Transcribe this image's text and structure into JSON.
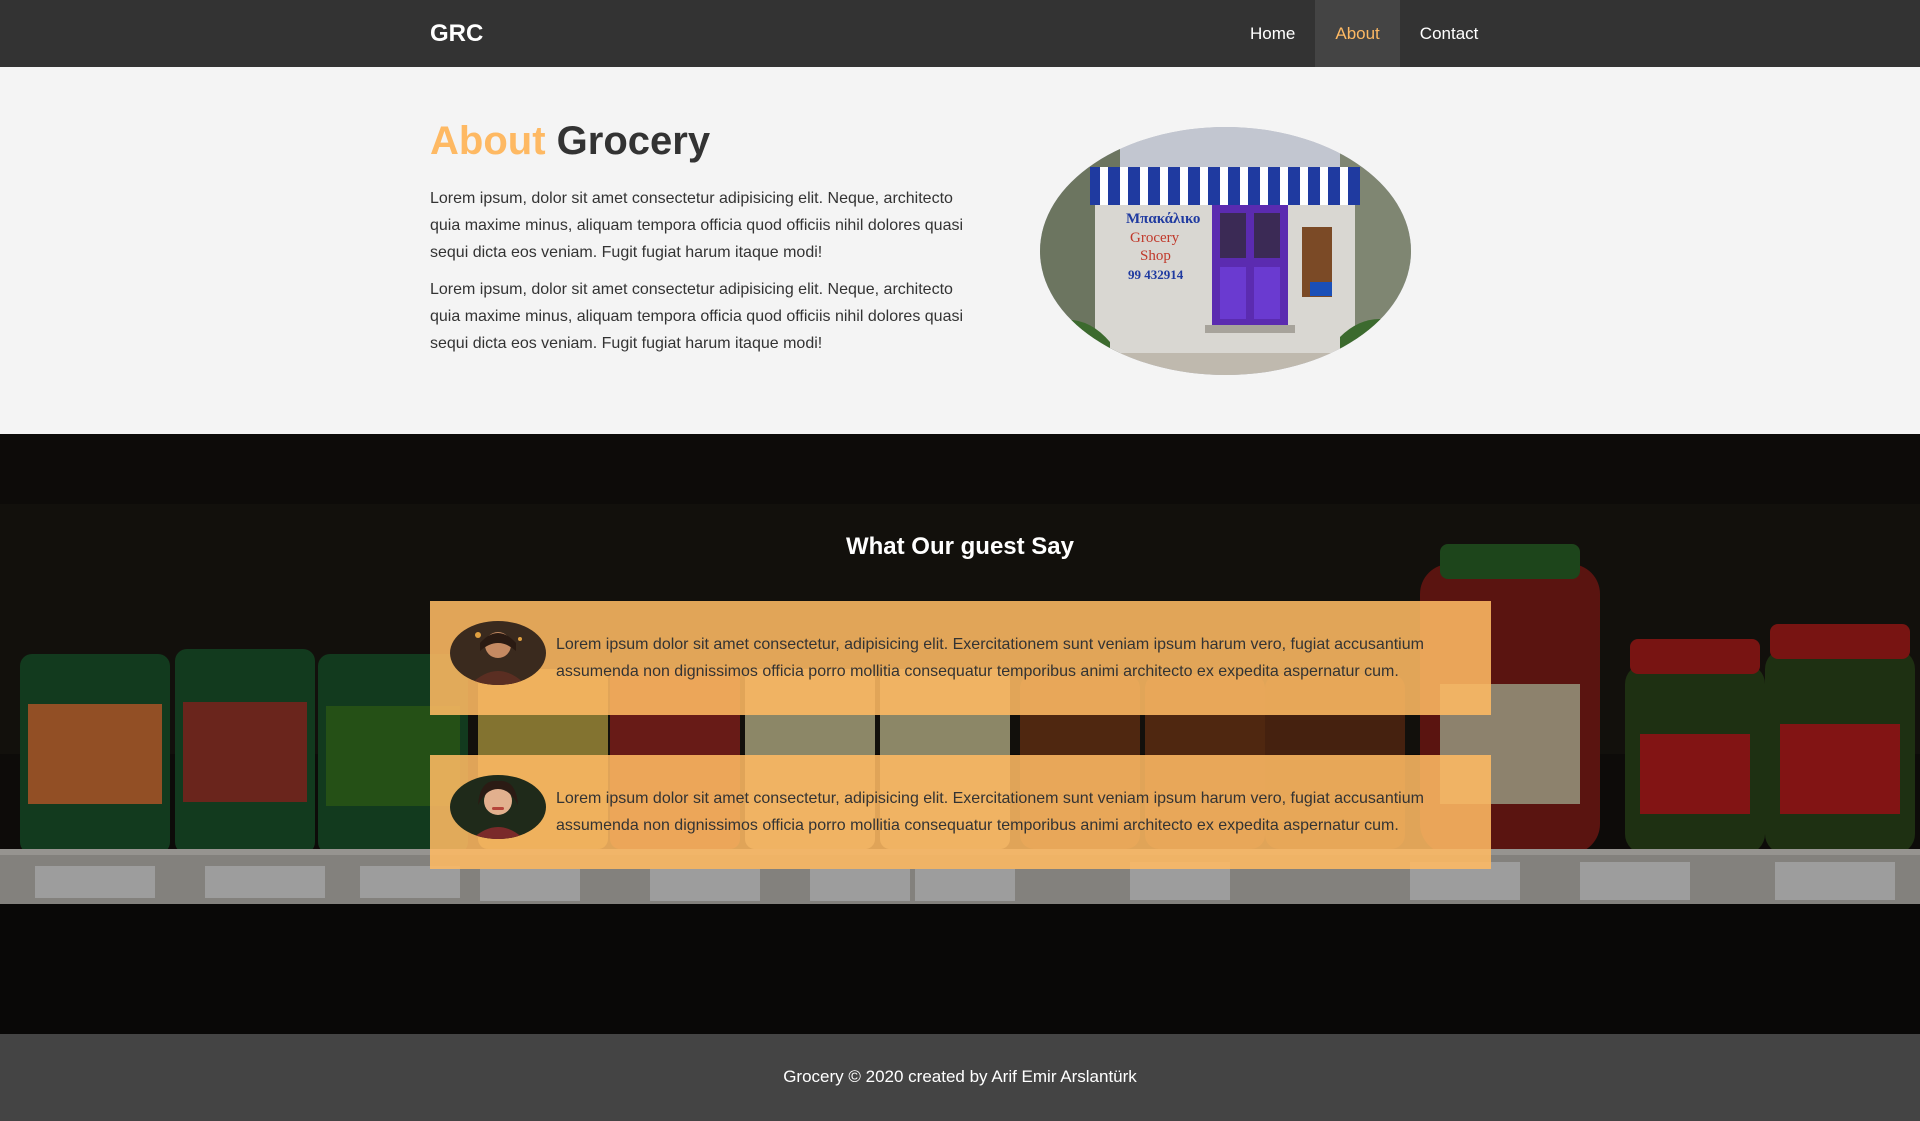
{
  "header": {
    "brand": "GRC",
    "nav": [
      {
        "label": "Home",
        "active": false
      },
      {
        "label": "About",
        "active": true
      },
      {
        "label": "Contact",
        "active": false
      }
    ]
  },
  "about": {
    "title_accent": "About",
    "title_rest": "Grocery",
    "paragraphs": [
      "Lorem ipsum, dolor sit amet consectetur adipisicing elit. Neque, architecto quia maxime minus, aliquam tempora officia quod officiis nihil dolores quasi sequi dicta eos veniam. Fugit fugiat harum itaque modi!",
      "Lorem ipsum, dolor sit amet consectetur adipisicing elit. Neque, architecto quia maxime minus, aliquam tempora officia quod officiis nihil dolores quasi sequi dicta eos veniam. Fugit fugiat harum itaque modi!"
    ],
    "shop_sign": {
      "line1": "Μπακάλικο",
      "line2": "Grocery",
      "line3": "Shop",
      "line4": "99 432914"
    }
  },
  "testimonials": {
    "title": "What Our guest Say",
    "items": [
      {
        "text": "Lorem ipsum dolor sit amet consectetur, adipisicing elit. Exercitationem sunt veniam ipsum harum vero, fugiat accusantium assumenda non dignissimos officia porro mollitia consequatur temporibus animi architecto ex expedita aspernatur cum."
      },
      {
        "text": "Lorem ipsum dolor sit amet consectetur, adipisicing elit. Exercitationem sunt veniam ipsum harum vero, fugiat accusantium assumenda non dignissimos officia porro mollitia consequatur temporibus animi architecto ex expedita aspernatur cum."
      }
    ]
  },
  "footer": {
    "text": "Grocery © 2020 created by Arif Emir Arslantürk"
  },
  "colors": {
    "accent": "#feb963",
    "nav_bg": "#333333",
    "footer_bg": "#444444",
    "page_bg": "#f4f4f4"
  }
}
